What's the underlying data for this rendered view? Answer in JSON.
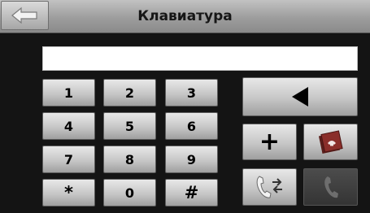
{
  "header": {
    "title": "Клавиатура",
    "back_icon": "back-arrow-icon"
  },
  "input": {
    "value": ""
  },
  "keypad": {
    "keys": [
      "1",
      "2",
      "3",
      "4",
      "5",
      "6",
      "7",
      "8",
      "9",
      "*",
      "0",
      "#"
    ]
  },
  "actions": {
    "backspace_icon": "backspace-triangle-icon",
    "plus_label": "+",
    "contacts_icon": "phonebook-icon",
    "transfer_icon": "call-transfer-icon",
    "call_icon": "call-handset-icon"
  },
  "colors": {
    "background": "#141414",
    "button_light": "#c6c6c6",
    "phonebook_red": "#8a2e2a"
  }
}
